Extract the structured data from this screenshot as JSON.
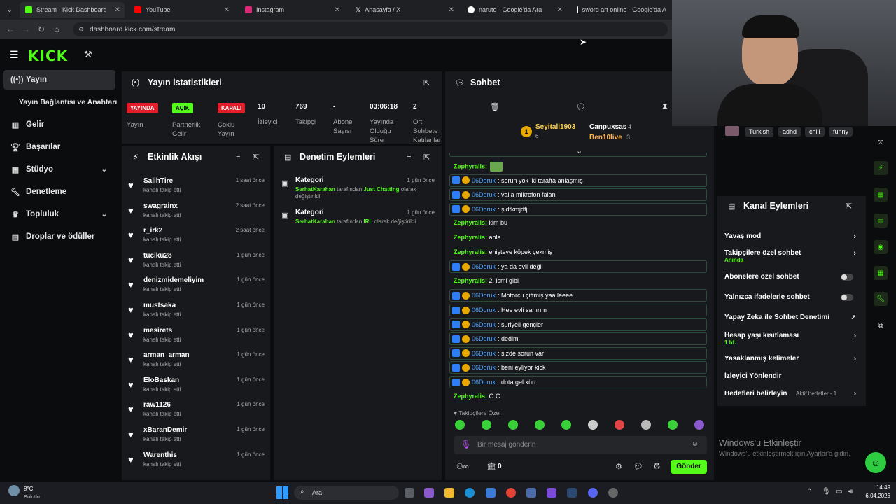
{
  "browser": {
    "tabs": [
      {
        "label": "Stream - Kick Dashboard"
      },
      {
        "label": "YouTube"
      },
      {
        "label": "Instagram"
      },
      {
        "label": "Anasayfa / X"
      },
      {
        "label": "naruto - Google'da Ara"
      },
      {
        "label": "sword art online - Google'da A"
      }
    ],
    "url": "dashboard.kick.com/stream"
  },
  "sidebar": {
    "items": [
      {
        "label": "Yayın"
      },
      {
        "label": "Yayın Bağlantısı ve Anahtarı"
      },
      {
        "label": "Gelir"
      },
      {
        "label": "Başarılar"
      },
      {
        "label": "Stüdyo"
      },
      {
        "label": "Denetleme"
      },
      {
        "label": "Topluluk"
      },
      {
        "label": "Droplar ve ödüller"
      }
    ]
  },
  "stats": {
    "title": "Yayın İstatistikleri",
    "badges": [
      {
        "text": "YAYINDA",
        "label": "Yayın"
      },
      {
        "text": "AÇIK",
        "label": "Partnerlik Gelir"
      },
      {
        "text": "KAPALI",
        "label": "Çoklu Yayın"
      }
    ],
    "values": [
      {
        "value": "10",
        "label": "İzleyici"
      },
      {
        "value": "769",
        "label": "Takipçi"
      },
      {
        "value": "-",
        "label": "Abone Sayısı"
      },
      {
        "value": "03:06:18",
        "label": "Yayında Olduğu Süre"
      },
      {
        "value": "2",
        "label": "Ort. Sohbete Katılanlar"
      }
    ]
  },
  "feed": {
    "title": "Etkinlik Akışı",
    "sub": "kanalı takip etti",
    "items": [
      {
        "name": "SalihTire",
        "time": "1 saat önce"
      },
      {
        "name": "swagrainx",
        "time": "2 saat önce"
      },
      {
        "name": "r_irk2",
        "time": "2 saat önce"
      },
      {
        "name": "tuciku28",
        "time": "1 gün önce"
      },
      {
        "name": "denizmidemeliyim",
        "time": "1 gün önce"
      },
      {
        "name": "mustsaka",
        "time": "1 gün önce"
      },
      {
        "name": "mesirets",
        "time": "1 gün önce"
      },
      {
        "name": "arman_arman",
        "time": "1 gün önce"
      },
      {
        "name": "EloBaskan",
        "time": "1 gün önce"
      },
      {
        "name": "raw1126",
        "time": "1 gün önce"
      },
      {
        "name": "xBaranDemir",
        "time": "1 gün önce"
      },
      {
        "name": "Warenthis",
        "time": "1 gün önce"
      }
    ]
  },
  "mod": {
    "title": "Denetim Eylemleri",
    "items": [
      {
        "title": "Kategori",
        "time": "1 gün önce",
        "user": "SerhatKarahan",
        "mid": " tarafından ",
        "cat": "Just Chatting",
        "end": " olarak değiştirildi"
      },
      {
        "title": "Kategori",
        "time": "1 gün önce",
        "user": "SerhatKarahan",
        "mid": " tarafından ",
        "cat": "IRL",
        "end": " olarak değiştirildi"
      }
    ]
  },
  "chat": {
    "title": "Sohbet",
    "top": {
      "rank": "1",
      "user": "Seyitali1903",
      "sub": "6",
      "second": "Canpuxsas",
      "second_n": "4",
      "third": "Ben10live",
      "third_n": "3"
    },
    "messages": [
      {
        "user": "Zephyralis:",
        "text": "",
        "boxed": false
      },
      {
        "user": "06Doruk",
        "text": ": sorun yok iki tarafta anlaşmış",
        "boxed": true
      },
      {
        "user": "06Doruk",
        "text": ": valla mikrofon falan",
        "boxed": true
      },
      {
        "user": "06Doruk",
        "text": ": şldfkmjdfj",
        "boxed": true
      },
      {
        "user": "Zephyralis:",
        "text": " kim bu",
        "boxed": false
      },
      {
        "user": "Zephyralis:",
        "text": " abla",
        "boxed": false
      },
      {
        "user": "Zephyralis:",
        "text": " enişteye köpek çekmiş",
        "boxed": false
      },
      {
        "user": "06Doruk",
        "text": ": ya da evli değil",
        "boxed": true
      },
      {
        "user": "Zephyralis:",
        "text": " 2. ismi gibi",
        "boxed": false
      },
      {
        "user": "06Doruk",
        "text": ": Motorcu çiftmiş yaa leeee",
        "boxed": true
      },
      {
        "user": "06Doruk",
        "text": ": Hee evli sanırım",
        "boxed": true
      },
      {
        "user": "06Doruk",
        "text": ": suriyeli gençler",
        "boxed": true
      },
      {
        "user": "06Doruk",
        "text": ": dedim",
        "boxed": true
      },
      {
        "user": "06Doruk",
        "text": ": sizde sorun var",
        "boxed": true
      },
      {
        "user": "06Doruk",
        "text": ": beni eyliyor kick",
        "boxed": true
      },
      {
        "user": "06Doruk",
        "text": ": dota gel kürt",
        "boxed": true
      },
      {
        "user": "Zephyralis:",
        "text": " O   C",
        "boxed": false
      }
    ],
    "followers_only": "Takipçilere Özel",
    "input_placeholder": "Bir mesaj gönderin",
    "send": "Gönder",
    "count": "0"
  },
  "tags": [
    "Turkish",
    "adhd",
    "chill",
    "funny"
  ],
  "channel": {
    "title": "Kanal Eylemleri",
    "items": [
      {
        "label": "Yavaş mod",
        "sub": ""
      },
      {
        "label": "Takipçilere özel sohbet",
        "sub": "Anında"
      },
      {
        "label": "Abonelere özel sohbet",
        "sub": ""
      },
      {
        "label": "Yalnızca ifadelerle sohbet",
        "sub": ""
      },
      {
        "label": "Yapay Zeka ile Sohbet Denetimi",
        "sub": ""
      },
      {
        "label": "Hesap yaşı kısıtlaması",
        "sub": "1 hf."
      },
      {
        "label": "Yasaklanmış kelimeler",
        "sub": ""
      },
      {
        "label": "İzleyici Yönlendir",
        "sub": ""
      },
      {
        "label": "Hedefleri belirleyin",
        "sub": "Aktif hedefler - 1"
      }
    ]
  },
  "watermark": {
    "title": "Windows'u Etkinleştir",
    "sub": "Windows'u etkinleştirmek için Ayarlar'a gidin."
  },
  "taskbar": {
    "weather": "8°C",
    "weather_sub": "Bulutlu",
    "search": "Ara",
    "time": "14:49",
    "date": "6.04.2026"
  }
}
